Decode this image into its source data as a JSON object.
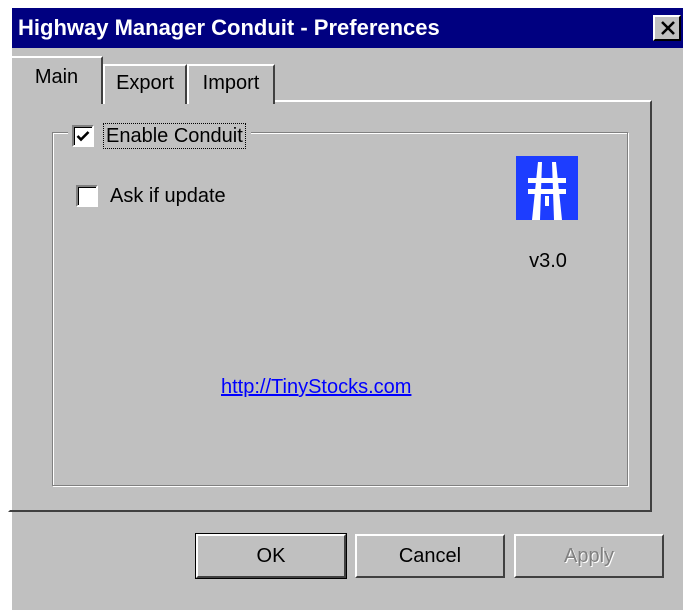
{
  "window": {
    "title": "Highway Manager Conduit - Preferences",
    "titlebar_color": "#000080"
  },
  "tabs": [
    {
      "label": "Main",
      "selected": true
    },
    {
      "label": "Export",
      "selected": false
    },
    {
      "label": "Import",
      "selected": false
    }
  ],
  "main": {
    "enable_conduit": {
      "label": "Enable Conduit",
      "checked": true
    },
    "ask_if_update": {
      "label": "Ask if update",
      "checked": false
    },
    "logo": {
      "icon": "highway-icon",
      "color": "#1d3dff"
    },
    "version": "v3.0",
    "link": "http://TinyStocks.com"
  },
  "buttons": {
    "ok": "OK",
    "cancel": "Cancel",
    "apply": "Apply"
  }
}
